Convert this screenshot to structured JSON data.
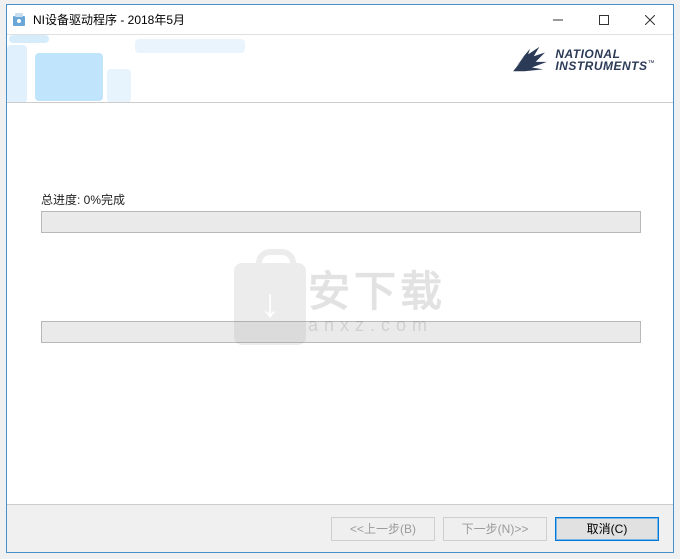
{
  "window": {
    "title": "NI设备驱动程序 - 2018年5月"
  },
  "logo": {
    "line1": "NATIONAL",
    "line2": "INSTRUMENTS",
    "tm": "™"
  },
  "progress": {
    "label": "总进度: 0%完成",
    "main_percent": 0,
    "secondary_percent": 0
  },
  "watermark": {
    "main": "安下载",
    "sub": "anxz.com"
  },
  "buttons": {
    "back": "<<上一步(B)",
    "next": "下一步(N)>>",
    "cancel": "取消(C)"
  }
}
